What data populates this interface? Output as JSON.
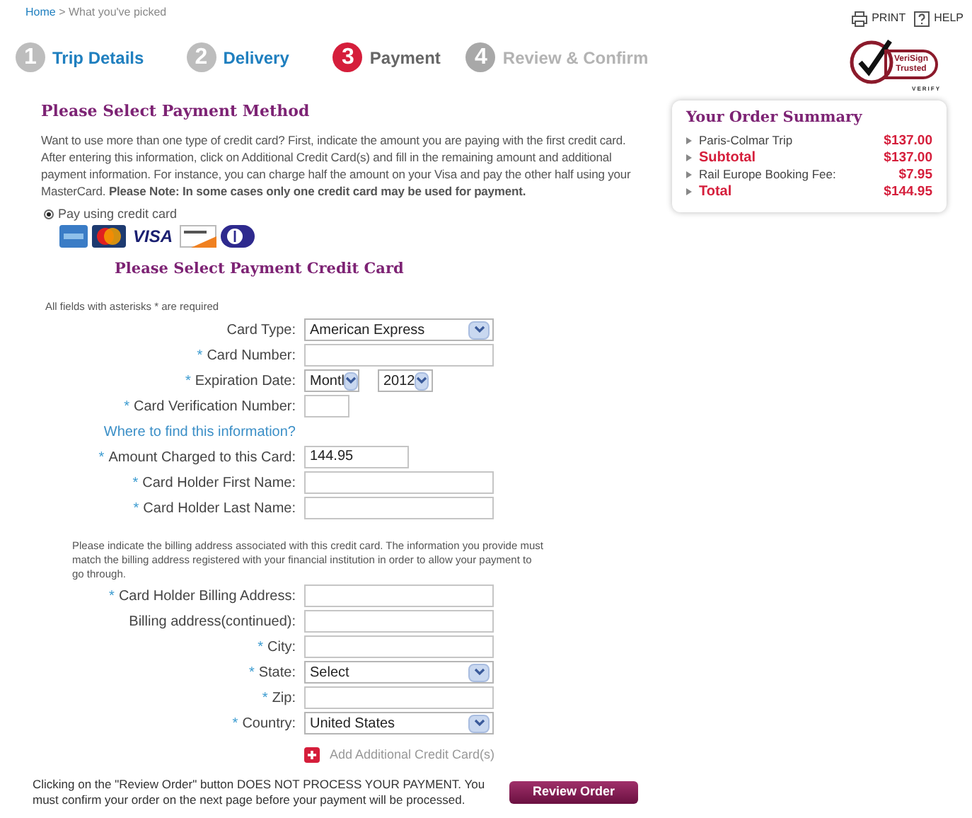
{
  "breadcrumb": {
    "home": "Home",
    "separator": ">",
    "current": "What you've picked"
  },
  "utility_links": [
    {
      "kind": "print",
      "label": "PRINT"
    },
    {
      "kind": "help",
      "label": "HELP"
    }
  ],
  "steps": [
    {
      "number": "1",
      "label": "Trip Details",
      "completed": true,
      "selected": false
    },
    {
      "number": "2",
      "label": "Delivery",
      "completed": true,
      "selected": false
    },
    {
      "number": "3",
      "label": "Payment",
      "completed": false,
      "selected": true
    },
    {
      "number": "4",
      "label": "Review & Confirm",
      "completed": false,
      "selected": false
    }
  ],
  "seal": {
    "line1": "VeriSign",
    "line2": "Trusted",
    "verify": "VERIFY"
  },
  "payment_method": {
    "title": "Please Select Payment Method",
    "intro": "Want to use more than one type of credit card? First, indicate the amount you are paying with the first credit card. After entering this information, click on Additional Credit Card(s) and fill in the remaining amount and additional payment information. For instance, you can charge half the amount on your Visa and pay the other half using your MasterCard. **Please Note: In some cases only one credit card may be used for payment.**",
    "option": {
      "label": "Pay using credit card",
      "selected": true
    },
    "cards": [
      {
        "kind": "amex"
      },
      {
        "kind": "mastercard"
      },
      {
        "kind": "visa",
        "text": "VISA"
      },
      {
        "kind": "discover"
      },
      {
        "kind": "diners"
      }
    ]
  },
  "card_form": {
    "title": "Please Select Payment Credit Card",
    "required_note": "All fields with asterisks * are required",
    "fields": [
      {
        "label": "Card Type:",
        "kind": "select",
        "value": "American Express"
      },
      {
        "asterisk": "*",
        "label": "Card Number:",
        "kind": "text"
      },
      {
        "asterisk": "*",
        "label": "Expiration Date:",
        "kind": "date",
        "month": "Montl",
        "year": "2012"
      },
      {
        "asterisk": "*",
        "label": "Card Verification Number:",
        "kind": "small"
      },
      {
        "kind": "link",
        "label": "Where to find this information?"
      },
      {
        "asterisk": "*",
        "label": "Amount Charged to this Card:",
        "kind": "amount",
        "value": "144.95"
      },
      {
        "asterisk": "*",
        "label": "Card Holder First Name:",
        "kind": "text"
      },
      {
        "asterisk": "*",
        "label": "Card Holder Last Name:",
        "kind": "text"
      }
    ]
  },
  "billing": {
    "note": "Please indicate the billing address associated with this credit card. The information you provide must match the billing address registered with your financial institution in order to allow your payment to go through.",
    "fields": [
      {
        "asterisk": "*",
        "label": "Card Holder Billing Address:",
        "kind": "text"
      },
      {
        "label": "Billing address(continued):",
        "kind": "text"
      },
      {
        "asterisk": "*",
        "label": "City:",
        "kind": "text"
      },
      {
        "asterisk": "*",
        "label": "State:",
        "kind": "select",
        "value": "Select"
      },
      {
        "asterisk": "*",
        "label": "Zip:",
        "kind": "text"
      },
      {
        "asterisk": "*",
        "label": "Country:",
        "kind": "select",
        "value": "United States"
      }
    ]
  },
  "add_card": "Add Additional Credit Card(s)",
  "footer": {
    "note": "Clicking on the \"Review Order\" button DOES NOT PROCESS YOUR PAYMENT. You must confirm your order on the next page before your payment will be processed.",
    "button": "Review Order"
  },
  "order_summary": {
    "title": "Your Order Summary",
    "rows": [
      {
        "label": "Paris-Colmar Trip",
        "amount": "$137.00",
        "emphasis": false
      },
      {
        "label": "Subtotal",
        "amount": "$137.00",
        "emphasis": true
      },
      {
        "label": "Rail Europe Booking Fee:",
        "amount": "$7.95",
        "emphasis": false
      },
      {
        "label": "Total",
        "amount": "$144.95",
        "emphasis": true
      }
    ]
  }
}
